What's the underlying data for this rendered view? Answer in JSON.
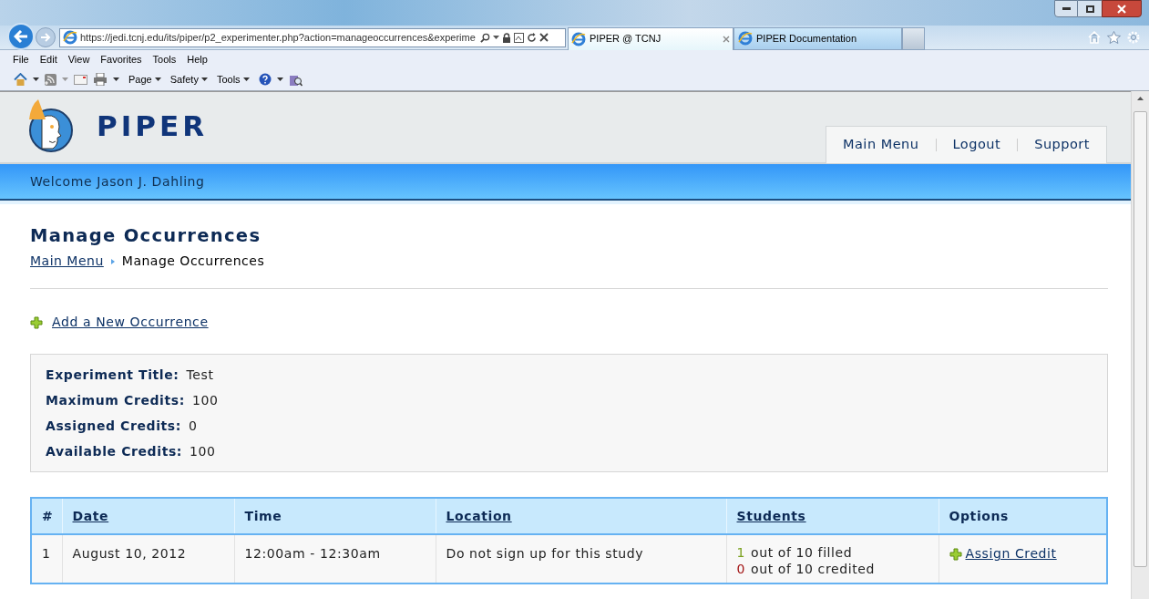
{
  "browser": {
    "address": "https://jedi.tcnj.edu/its/piper/p2_experimenter.php?action=manageoccurrences&experime",
    "tabs": [
      {
        "label": "PIPER @ TCNJ",
        "selected": true
      },
      {
        "label": "PIPER Documentation",
        "selected": false
      }
    ],
    "menu": [
      "File",
      "Edit",
      "View",
      "Favorites",
      "Tools",
      "Help"
    ],
    "commands": [
      "Page",
      "Safety",
      "Tools"
    ]
  },
  "site": {
    "logo": "PIPER",
    "nav": [
      "Main Menu",
      "Logout",
      "Support"
    ],
    "welcome": "Welcome Jason J. Dahling"
  },
  "page": {
    "title": "Manage Occurrences",
    "breadcrumb": [
      {
        "label": "Main Menu",
        "link": true
      },
      {
        "label": "Manage Occurrences",
        "link": false
      }
    ],
    "add_link": "Add a New Occurrence",
    "summary": [
      {
        "label": "Experiment Title:",
        "value": "Test"
      },
      {
        "label": "Maximum Credits:",
        "value": "100"
      },
      {
        "label": "Assigned Credits:",
        "value": "0"
      },
      {
        "label": "Available Credits:",
        "value": "100"
      }
    ]
  },
  "table": {
    "columns": [
      {
        "label": "#",
        "link": false
      },
      {
        "label": "Date",
        "link": true
      },
      {
        "label": "Time",
        "link": false
      },
      {
        "label": "Location",
        "link": true
      },
      {
        "label": "Students",
        "link": true
      },
      {
        "label": "Options",
        "link": false
      }
    ],
    "rows": [
      {
        "number": "1",
        "date": "August 10, 2012",
        "time": "12:00am - 12:30am",
        "location": "Do not sign up for this study",
        "students": [
          {
            "count": "1",
            "text": "out of 10 filled",
            "color": "#7aa11e"
          },
          {
            "count": "0",
            "text": "out of 10 credited",
            "color": "#a31515"
          }
        ],
        "option": "Assign Credit"
      }
    ]
  }
}
